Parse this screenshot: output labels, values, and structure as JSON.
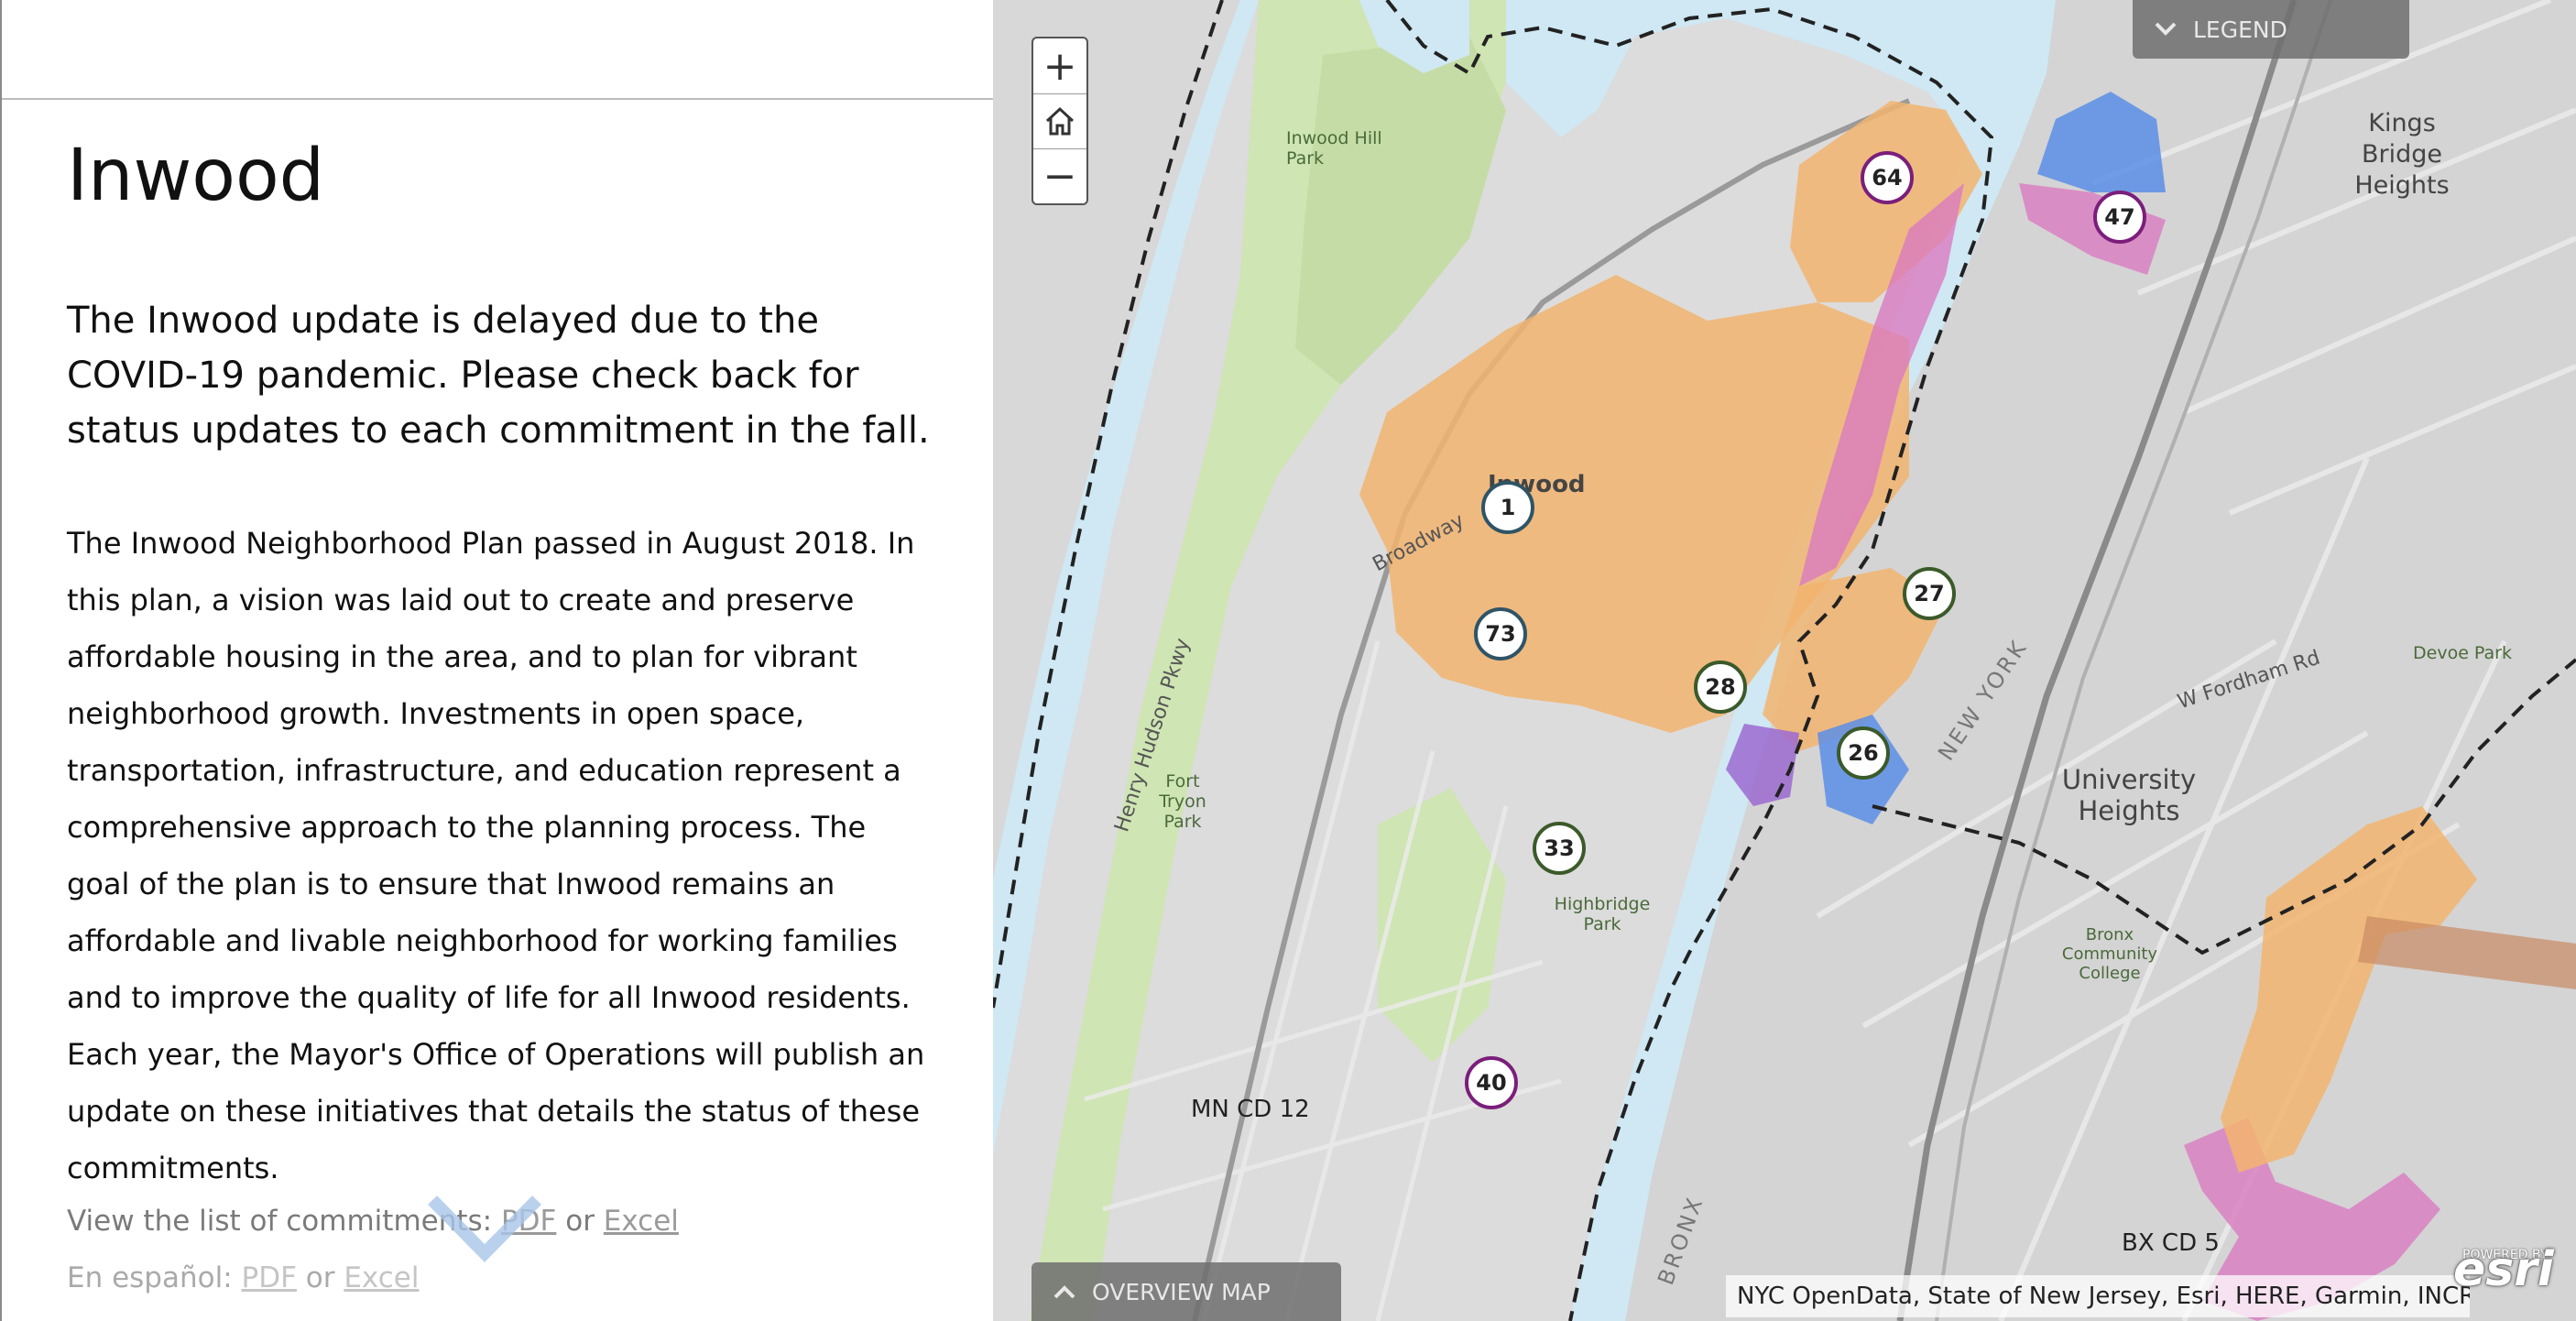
{
  "panel": {
    "title": "Inwood",
    "intro": "The Inwood update is delayed due to the COVID-19 pandemic. Please check back for status updates to each commitment in the fall.",
    "body": "The Inwood Neighborhood Plan passed in August 2018. In this plan, a vision was laid out to create and preserve affordable housing in the area, and to plan for vibrant neighborhood growth. Investments in open space, transportation, infrastructure, and education represent a comprehensive approach to the planning process. The goal of the plan is to ensure that Inwood remains an affordable and livable neighborhood for working families and to improve the quality of life for all Inwood residents. Each year, the Mayor's Office of Operations will publish an update on these initiatives that details the status of these commitments.",
    "links_english": {
      "prefix": "View the list of commitments: ",
      "pdf": "PDF",
      "or": " or ",
      "excel": "Excel"
    },
    "links_spanish": {
      "prefix": "En español: ",
      "pdf": "PDF",
      "or": " or ",
      "excel": "Excel"
    }
  },
  "map": {
    "zoom_in": "+",
    "zoom_out": "−",
    "legend_label": "LEGEND",
    "overview_label": "OVERVIEW MAP",
    "attribution": "NYC OpenData, State of New Jersey, Esri, HERE, Garmin, INCR...",
    "esri_logo": "esri",
    "esri_powered": "POWERED BY",
    "markers": [
      "64",
      "47",
      "1",
      "73",
      "27",
      "28",
      "26",
      "33",
      "40"
    ],
    "labels": {
      "inwood": "Inwood",
      "inwood_hill_park": "Inwood Hill Park",
      "kings_bridge_heights": "Kings Bridge Heights",
      "university_heights": "University Heights",
      "fort_tryon_park": "Fort Tryon Park",
      "highbridge_park": "Highbridge Park",
      "bronx_cc": "Bronx Community College",
      "mn_cd_12": "MN CD 12",
      "bx_cd_5": "BX CD 5",
      "w_fordham_rd": "W Fordham Rd",
      "broadway": "Broadway",
      "henry_hudson": "Henry Hudson Pkwy",
      "new_york": "NEW YORK",
      "bronx": "BRONX",
      "devoe_park": "Devoe Park"
    },
    "colors": {
      "orange_zone": "#f2b46f",
      "pink_zone": "#d97bc0",
      "blue_zone": "#5b8ee6",
      "purple_zone": "#9b6ad0",
      "water": "#cfe8f3",
      "park": "#cfe5b4"
    }
  }
}
